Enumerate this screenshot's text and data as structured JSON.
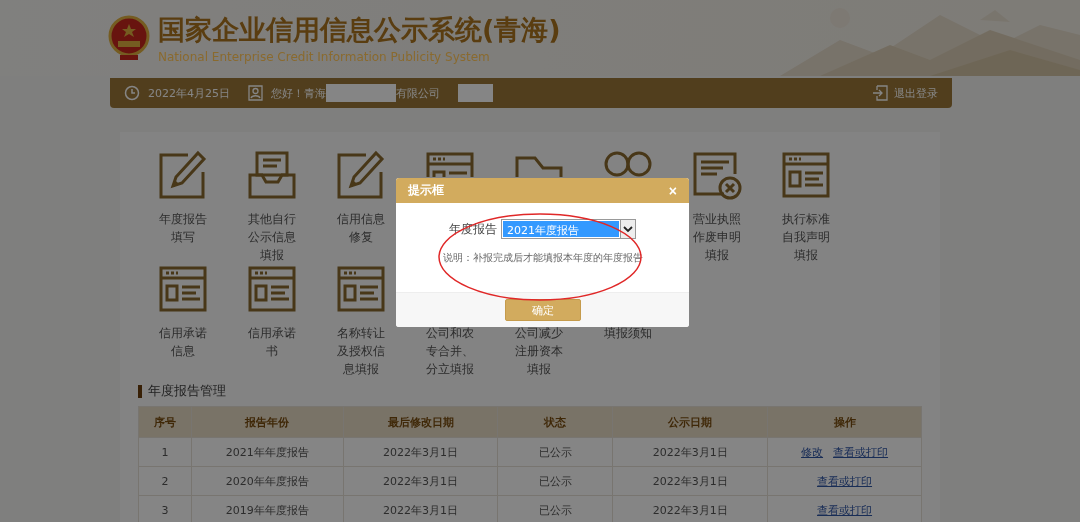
{
  "header": {
    "title": "国家企业信用信息公示系统(青海)",
    "subtitle": "National Enterprise Credit Information Publicity System"
  },
  "info_bar": {
    "date": "2022年4月25日",
    "greeting": "您好！青海",
    "company_suffix": "有限公司",
    "logout": "退出登录"
  },
  "services": [
    {
      "kind": "edit",
      "lines": [
        "年度报告",
        "填写"
      ]
    },
    {
      "kind": "inbox",
      "lines": [
        "其他自行",
        "公示信息",
        "填报"
      ]
    },
    {
      "kind": "edit",
      "lines": [
        "信用信息",
        "修复"
      ]
    },
    {
      "kind": "window"
    },
    {
      "kind": "folder"
    },
    {
      "kind": "circles"
    },
    {
      "kind": "cancel",
      "lines": [
        "营业执照",
        "作废申明",
        "填报"
      ]
    },
    {
      "kind": "window",
      "lines": [
        "执行标准",
        "自我声明",
        "填报"
      ]
    },
    {
      "kind": "window",
      "lines": [
        "信用承诺",
        "信息"
      ]
    },
    {
      "kind": "window",
      "lines": [
        "信用承诺",
        "书"
      ]
    },
    {
      "kind": "window",
      "lines": [
        "名称转让",
        "及授权信",
        "息填报"
      ]
    },
    {
      "kind": "none",
      "lines": [
        "公司和农",
        "专合并、",
        "分立填报"
      ]
    },
    {
      "kind": "none",
      "lines": [
        "公司减少",
        "注册资本",
        "填报"
      ]
    },
    {
      "kind": "none",
      "lines": [
        "填报须知"
      ]
    }
  ],
  "section_title": "年度报告管理",
  "table": {
    "columns": [
      "序号",
      "报告年份",
      "最后修改日期",
      "状态",
      "公示日期",
      "操作"
    ],
    "rows": [
      {
        "cells": [
          "1",
          "2021年年度报告",
          "2022年3月1日",
          "已公示",
          "2022年3月1日"
        ],
        "actions": [
          "修改",
          "查看或打印"
        ]
      },
      {
        "cells": [
          "2",
          "2020年年度报告",
          "2022年3月1日",
          "已公示",
          "2022年3月1日"
        ],
        "actions": [
          "查看或打印"
        ]
      },
      {
        "cells": [
          "3",
          "2019年年度报告",
          "2022年3月1日",
          "已公示",
          "2022年3月1日"
        ],
        "actions": [
          "查看或打印"
        ]
      }
    ]
  },
  "dialog": {
    "title": "提示框",
    "close": "×",
    "field_label": "年度报告",
    "select_value": "2021年度报告",
    "note": "说明：补报完成后才能填报本年度的年度报告",
    "confirm": "确定"
  }
}
